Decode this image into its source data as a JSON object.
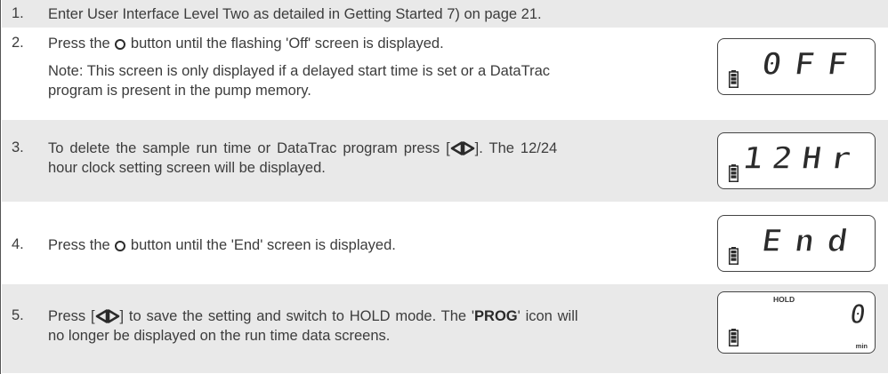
{
  "steps": [
    {
      "number": "1.",
      "lines": [
        "Enter User Interface Level Two as detailed in Getting Started 7) on page 21."
      ]
    },
    {
      "number": "2.",
      "pre_icon": "Press the",
      "icon": "circle-button-icon",
      "post_icon": "button until the flashing 'Off' screen is displayed.",
      "note_lines": [
        "Note: This screen is only displayed if a delayed start time is set or a DataTrac",
        "program is present in the pump memory."
      ],
      "lcd": {
        "display": "0FF"
      }
    },
    {
      "number": "3.",
      "line1_pre": "To delete the sample run time or DataTrac program press [",
      "icon": "left-right-arrows-icon",
      "line1_post": "]. The 12/24",
      "line2": "hour clock setting screen will be displayed.",
      "lcd": {
        "display": "12Hr"
      }
    },
    {
      "number": "4.",
      "pre_icon": "Press the",
      "icon": "circle-button-icon",
      "post_icon": "button until the 'End' screen is displayed.",
      "lcd": {
        "display": "End"
      }
    },
    {
      "number": "5.",
      "line1_pre": "Press [",
      "icon": "left-right-arrows-icon",
      "line1_mid": "] to save the setting and switch to HOLD mode. The '",
      "bold": "PROG",
      "line1_post": "' icon will",
      "line2": "no longer be displayed on the run time data screens.",
      "lcd": {
        "top_label": "HOLD",
        "value": "0",
        "unit": "min"
      }
    }
  ],
  "colors": {
    "shade": "#e9e9e9",
    "text": "#3c3c3c",
    "lcd_border": "#444444"
  }
}
